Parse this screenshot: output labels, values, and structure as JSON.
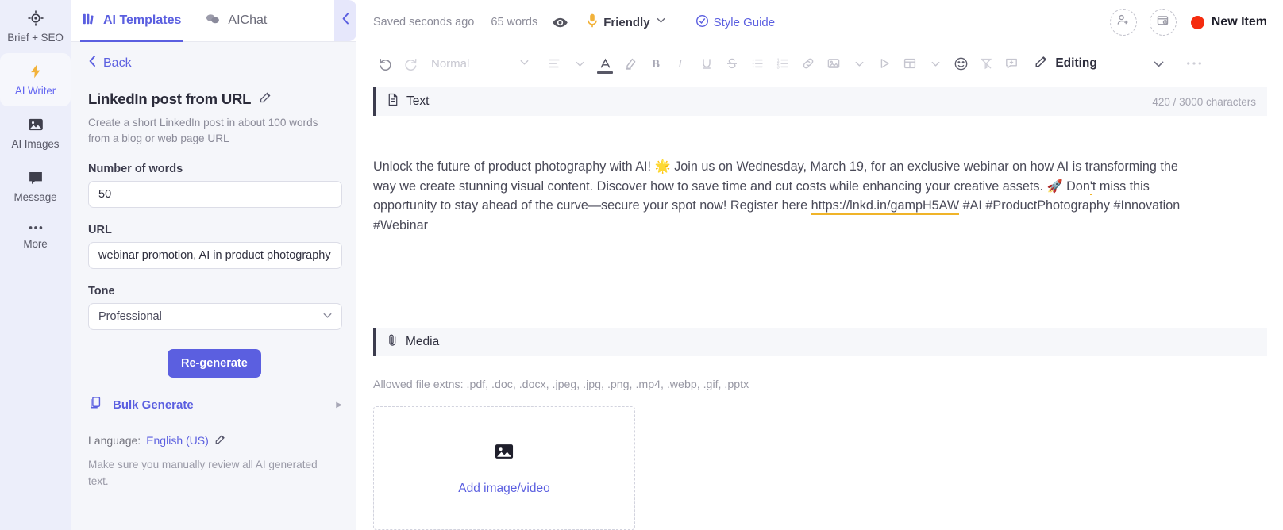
{
  "rail": {
    "items": [
      {
        "label": "Brief + SEO",
        "icon": "target-icon",
        "active": false
      },
      {
        "label": "AI Writer",
        "icon": "lightning-bolt-icon",
        "active": true
      },
      {
        "label": "AI Images",
        "icon": "image-icon",
        "active": false
      },
      {
        "label": "Message",
        "icon": "chat-bubble-icon",
        "active": false
      },
      {
        "label": "More",
        "icon": "ellipsis-icon",
        "active": false
      }
    ]
  },
  "panel": {
    "tabs": [
      {
        "label": "AI Templates",
        "icon": "templates-grid-icon",
        "active": true
      },
      {
        "label": "AIChat",
        "icon": "chat-bubbles-icon",
        "active": false
      }
    ],
    "back_label": "Back",
    "template_title": "LinkedIn post from URL",
    "template_description": "Create a short LinkedIn post in about 100 words from a blog or web page URL",
    "fields": [
      {
        "label": "Number of words",
        "value": "50",
        "type": "text"
      },
      {
        "label": "URL",
        "value": "webinar promotion, AI in product photography",
        "type": "text"
      },
      {
        "label": "Tone",
        "value": "Professional",
        "type": "select"
      }
    ],
    "regenerate_label": "Re-generate",
    "bulk_generate_label": "Bulk Generate",
    "language_prefix": "Language:",
    "language_value": "English (US)",
    "disclaimer": "Make sure you manually review all AI generated text.",
    "collapse_icon": "chevron-left-icon"
  },
  "topbar": {
    "saved_text": "Saved seconds ago",
    "words_text": "65 words",
    "preview_icon": "eye-icon",
    "tone_label": "Friendly",
    "tone_icon": "microphone-icon",
    "style_guide_label": "Style Guide",
    "style_guide_icon": "check-circle-icon",
    "add_person_icon": "add-person-icon",
    "add_schedule_icon": "add-schedule-icon",
    "status_label": "New Item",
    "status_color": "#f52c0f"
  },
  "toolbar": {
    "undo_icon": "undo-icon",
    "redo_icon": "redo-icon",
    "style_label": "Normal",
    "style_caret_icon": "chevron-down-icon",
    "align_icon": "align-left-icon",
    "align_caret_icon": "chevron-down-icon",
    "text_color_icon": "text-color-A-icon",
    "highlight_icon": "highlighter-icon",
    "bold_icon": "bold-icon",
    "italic_icon": "italic-icon",
    "underline_icon": "underline-icon",
    "strikethrough_icon": "strikethrough-icon",
    "bullet_list_icon": "bullet-list-icon",
    "numbered_list_icon": "numbered-list-icon",
    "link_icon": "link-icon",
    "image_icon": "image-icon",
    "image_caret_icon": "chevron-down-icon",
    "video_icon": "play-triangle-icon",
    "table_icon": "table-icon",
    "table_caret_icon": "chevron-down-icon",
    "emoji_icon": "emoji-smiley-icon",
    "clear_format_icon": "clear-format-icon",
    "comment_icon": "add-comment-icon",
    "editing_icon": "pencil-icon",
    "editing_label": "Editing",
    "editing_caret_icon": "chevron-down-icon",
    "more_icon": "ellipsis-icon",
    "text_color_swatch": "#585866"
  },
  "document": {
    "text_section": {
      "icon": "document-icon",
      "title": "Text",
      "counter": "420 / 3000 characters"
    },
    "body": {
      "part1": "Unlock the future of product photography with AI! 🌟 Join us on Wednesday, March 19, for an exclusive webinar on how AI is transforming the way we create stunning visual content. Discover how to save time and cut costs while enhancing your creative assets. 🚀 Don",
      "apostrophe": "'",
      "part2": "t miss this opportunity to stay ahead of the curve—secure your spot now! Register here ",
      "link": "https://lnkd.in/gampH5AW",
      "part3": " #AI #ProductPhotography #Innovation #Webinar"
    },
    "media_section": {
      "icon": "paperclip-icon",
      "title": "Media",
      "allowed": "Allowed file extns: .pdf, .doc, .docx, .jpeg, .jpg, .png, .mp4, .webp, .gif, .pptx",
      "dropzone_icon": "image-placeholder-icon",
      "dropzone_label": "Add image/video"
    }
  }
}
